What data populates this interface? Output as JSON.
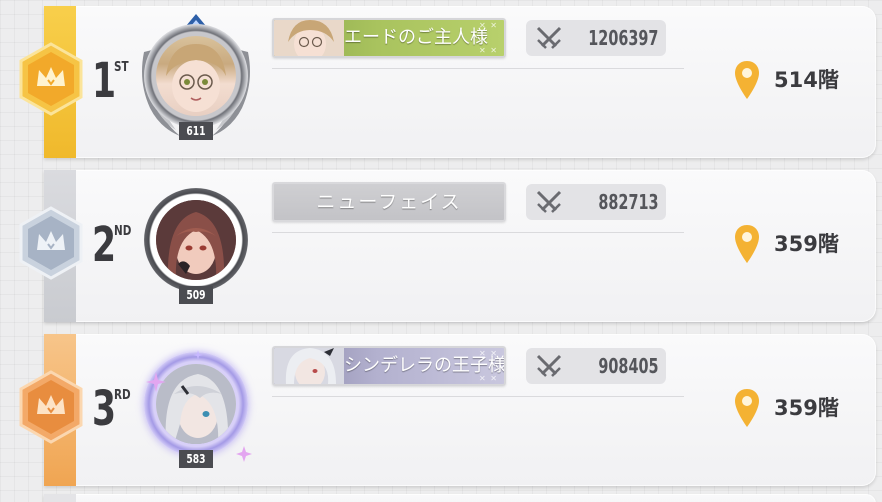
{
  "ranking": [
    {
      "rank": "1",
      "suffix": "ST",
      "medal": "gold",
      "level": "611",
      "player_name": "エードのご主人様",
      "battle_power": "1206397",
      "floor": "514階",
      "colors": {
        "stripe": "#f5c53c",
        "medal": "#f4b62e"
      }
    },
    {
      "rank": "2",
      "suffix": "ND",
      "medal": "silver",
      "level": "509",
      "player_name": "ニューフェイス",
      "battle_power": "882713",
      "floor": "359階",
      "colors": {
        "stripe": "#d3d4d8",
        "medal": "#b5c1d2"
      }
    },
    {
      "rank": "3",
      "suffix": "RD",
      "medal": "bronze",
      "level": "583",
      "player_name": "シンデレラの王子様",
      "battle_power": "908405",
      "floor": "359階",
      "colors": {
        "stripe": "#f4b46c",
        "medal": "#ec9a45"
      }
    }
  ],
  "icons": {
    "rank_medal": "crown-hexagon-icon",
    "battle_power": "crossed-swords-icon",
    "floor": "location-pin-icon"
  },
  "nameplate_decoration": "✕ ✕"
}
